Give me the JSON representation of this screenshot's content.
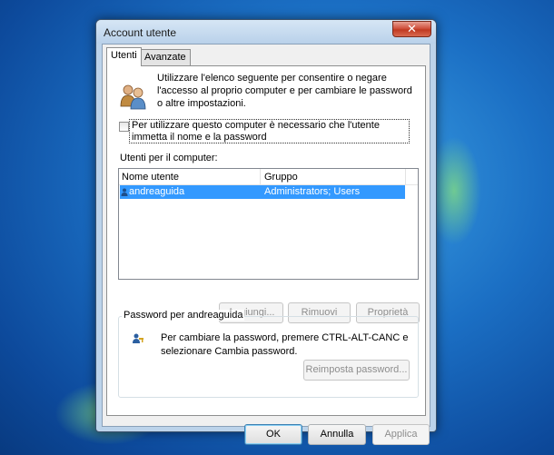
{
  "window": {
    "title": "Account utente",
    "close_glyph": "✕"
  },
  "tabs": [
    {
      "label": "Utenti",
      "active": true
    },
    {
      "label": "Avanzate",
      "active": false
    }
  ],
  "intro_text": "Utilizzare l'elenco seguente per consentire o negare l'accesso al proprio computer e per cambiare le password o altre impostazioni.",
  "require_password": {
    "label": "Per utilizzare questo computer è necessario che l'utente immetta il nome e la password",
    "checked": false
  },
  "users_section_label": "Utenti per il computer:",
  "users_table": {
    "columns": [
      "Nome utente",
      "Gruppo"
    ],
    "rows": [
      {
        "name": "andreaguida",
        "group": "Administrators; Users",
        "selected": true
      }
    ]
  },
  "list_buttons": {
    "add": "Aggiungi...",
    "remove": "Rimuovi",
    "properties": "Proprietà"
  },
  "password_group": {
    "title": "Password per andreaguida",
    "text": "Per cambiare la password, premere CTRL-ALT-CANC e selezionare Cambia password.",
    "reset_button": "Reimposta password..."
  },
  "dialog_buttons": {
    "ok": "OK",
    "cancel": "Annulla",
    "apply": "Applica"
  },
  "icons": {
    "users": "users-icon",
    "key": "key-user-icon",
    "close": "close-icon"
  },
  "colors": {
    "selection": "#3399ff",
    "close_button": "#c03a22",
    "desktop": "#1b6fc4"
  }
}
